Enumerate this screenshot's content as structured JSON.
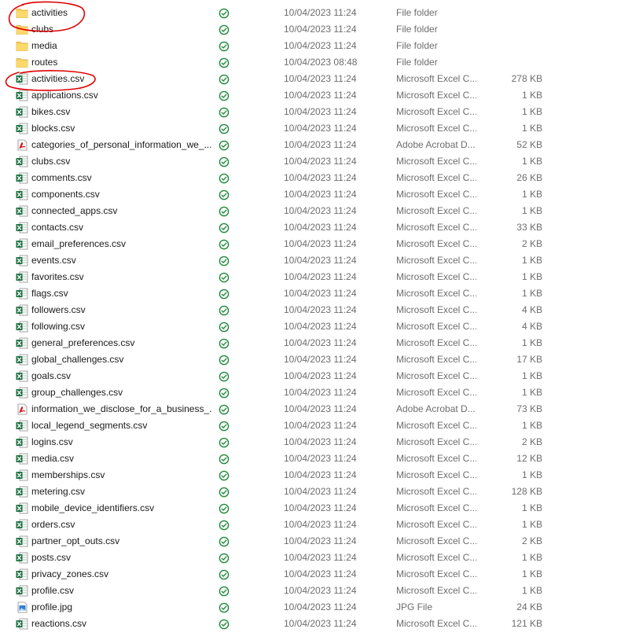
{
  "colors": {
    "annotation": "#e00000",
    "folder": "#f7cf5c",
    "excel": "#1d6f42",
    "pdf": "#d61e1e",
    "sync_ok": "#1e8a3a"
  },
  "files": [
    {
      "name": "activities",
      "date": "10/04/2023 11:24",
      "type": "File folder",
      "size": "",
      "icon": "folder-icon"
    },
    {
      "name": "clubs",
      "date": "10/04/2023 11:24",
      "type": "File folder",
      "size": "",
      "icon": "folder-icon"
    },
    {
      "name": "media",
      "date": "10/04/2023 11:24",
      "type": "File folder",
      "size": "",
      "icon": "folder-icon"
    },
    {
      "name": "routes",
      "date": "10/04/2023 08:48",
      "type": "File folder",
      "size": "",
      "icon": "folder-icon"
    },
    {
      "name": "activities.csv",
      "date": "10/04/2023 11:24",
      "type": "Microsoft Excel C...",
      "size": "278 KB",
      "icon": "excel-icon"
    },
    {
      "name": "applications.csv",
      "date": "10/04/2023 11:24",
      "type": "Microsoft Excel C...",
      "size": "1 KB",
      "icon": "excel-icon"
    },
    {
      "name": "bikes.csv",
      "date": "10/04/2023 11:24",
      "type": "Microsoft Excel C...",
      "size": "1 KB",
      "icon": "excel-icon"
    },
    {
      "name": "blocks.csv",
      "date": "10/04/2023 11:24",
      "type": "Microsoft Excel C...",
      "size": "1 KB",
      "icon": "excel-icon"
    },
    {
      "name": "categories_of_personal_information_we_...",
      "date": "10/04/2023 11:24",
      "type": "Adobe Acrobat D...",
      "size": "52 KB",
      "icon": "pdf-icon"
    },
    {
      "name": "clubs.csv",
      "date": "10/04/2023 11:24",
      "type": "Microsoft Excel C...",
      "size": "1 KB",
      "icon": "excel-icon"
    },
    {
      "name": "comments.csv",
      "date": "10/04/2023 11:24",
      "type": "Microsoft Excel C...",
      "size": "26 KB",
      "icon": "excel-icon"
    },
    {
      "name": "components.csv",
      "date": "10/04/2023 11:24",
      "type": "Microsoft Excel C...",
      "size": "1 KB",
      "icon": "excel-icon"
    },
    {
      "name": "connected_apps.csv",
      "date": "10/04/2023 11:24",
      "type": "Microsoft Excel C...",
      "size": "1 KB",
      "icon": "excel-icon"
    },
    {
      "name": "contacts.csv",
      "date": "10/04/2023 11:24",
      "type": "Microsoft Excel C...",
      "size": "33 KB",
      "icon": "excel-icon"
    },
    {
      "name": "email_preferences.csv",
      "date": "10/04/2023 11:24",
      "type": "Microsoft Excel C...",
      "size": "2 KB",
      "icon": "excel-icon"
    },
    {
      "name": "events.csv",
      "date": "10/04/2023 11:24",
      "type": "Microsoft Excel C...",
      "size": "1 KB",
      "icon": "excel-icon"
    },
    {
      "name": "favorites.csv",
      "date": "10/04/2023 11:24",
      "type": "Microsoft Excel C...",
      "size": "1 KB",
      "icon": "excel-icon"
    },
    {
      "name": "flags.csv",
      "date": "10/04/2023 11:24",
      "type": "Microsoft Excel C...",
      "size": "1 KB",
      "icon": "excel-icon"
    },
    {
      "name": "followers.csv",
      "date": "10/04/2023 11:24",
      "type": "Microsoft Excel C...",
      "size": "4 KB",
      "icon": "excel-icon"
    },
    {
      "name": "following.csv",
      "date": "10/04/2023 11:24",
      "type": "Microsoft Excel C...",
      "size": "4 KB",
      "icon": "excel-icon"
    },
    {
      "name": "general_preferences.csv",
      "date": "10/04/2023 11:24",
      "type": "Microsoft Excel C...",
      "size": "1 KB",
      "icon": "excel-icon"
    },
    {
      "name": "global_challenges.csv",
      "date": "10/04/2023 11:24",
      "type": "Microsoft Excel C...",
      "size": "17 KB",
      "icon": "excel-icon"
    },
    {
      "name": "goals.csv",
      "date": "10/04/2023 11:24",
      "type": "Microsoft Excel C...",
      "size": "1 KB",
      "icon": "excel-icon"
    },
    {
      "name": "group_challenges.csv",
      "date": "10/04/2023 11:24",
      "type": "Microsoft Excel C...",
      "size": "1 KB",
      "icon": "excel-icon"
    },
    {
      "name": "information_we_disclose_for_a_business_...",
      "date": "10/04/2023 11:24",
      "type": "Adobe Acrobat D...",
      "size": "73 KB",
      "icon": "pdf-icon"
    },
    {
      "name": "local_legend_segments.csv",
      "date": "10/04/2023 11:24",
      "type": "Microsoft Excel C...",
      "size": "1 KB",
      "icon": "excel-icon"
    },
    {
      "name": "logins.csv",
      "date": "10/04/2023 11:24",
      "type": "Microsoft Excel C...",
      "size": "2 KB",
      "icon": "excel-icon"
    },
    {
      "name": "media.csv",
      "date": "10/04/2023 11:24",
      "type": "Microsoft Excel C...",
      "size": "12 KB",
      "icon": "excel-icon"
    },
    {
      "name": "memberships.csv",
      "date": "10/04/2023 11:24",
      "type": "Microsoft Excel C...",
      "size": "1 KB",
      "icon": "excel-icon"
    },
    {
      "name": "metering.csv",
      "date": "10/04/2023 11:24",
      "type": "Microsoft Excel C...",
      "size": "128 KB",
      "icon": "excel-icon"
    },
    {
      "name": "mobile_device_identifiers.csv",
      "date": "10/04/2023 11:24",
      "type": "Microsoft Excel C...",
      "size": "1 KB",
      "icon": "excel-icon"
    },
    {
      "name": "orders.csv",
      "date": "10/04/2023 11:24",
      "type": "Microsoft Excel C...",
      "size": "1 KB",
      "icon": "excel-icon"
    },
    {
      "name": "partner_opt_outs.csv",
      "date": "10/04/2023 11:24",
      "type": "Microsoft Excel C...",
      "size": "2 KB",
      "icon": "excel-icon"
    },
    {
      "name": "posts.csv",
      "date": "10/04/2023 11:24",
      "type": "Microsoft Excel C...",
      "size": "1 KB",
      "icon": "excel-icon"
    },
    {
      "name": "privacy_zones.csv",
      "date": "10/04/2023 11:24",
      "type": "Microsoft Excel C...",
      "size": "1 KB",
      "icon": "excel-icon"
    },
    {
      "name": "profile.csv",
      "date": "10/04/2023 11:24",
      "type": "Microsoft Excel C...",
      "size": "1 KB",
      "icon": "excel-icon"
    },
    {
      "name": "profile.jpg",
      "date": "10/04/2023 11:24",
      "type": "JPG File",
      "size": "24 KB",
      "icon": "image-icon"
    },
    {
      "name": "reactions.csv",
      "date": "10/04/2023 11:24",
      "type": "Microsoft Excel C...",
      "size": "121 KB",
      "icon": "excel-icon"
    }
  ],
  "annotations": [
    {
      "target": "activities",
      "shape": "red-circle-highlight"
    },
    {
      "target": "activities.csv",
      "shape": "red-circle-highlight"
    }
  ]
}
